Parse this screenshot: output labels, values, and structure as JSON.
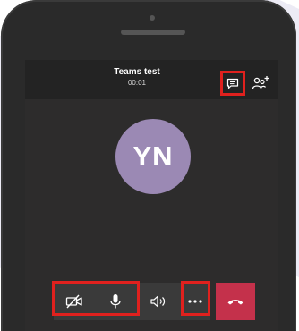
{
  "call": {
    "title": "Teams test",
    "timer": "00:01"
  },
  "participant": {
    "initials": "YN",
    "avatar_color": "#9b89b4"
  },
  "highlight_color": "#e0211e",
  "end_call_color": "#c4314b",
  "icons": {
    "chat": "chat-icon",
    "add_people": "add-people-icon",
    "camera_off": "camera-off-icon",
    "microphone": "microphone-icon",
    "speaker": "speaker-icon",
    "more": "more-options-icon",
    "end_call": "hang-up-icon"
  }
}
